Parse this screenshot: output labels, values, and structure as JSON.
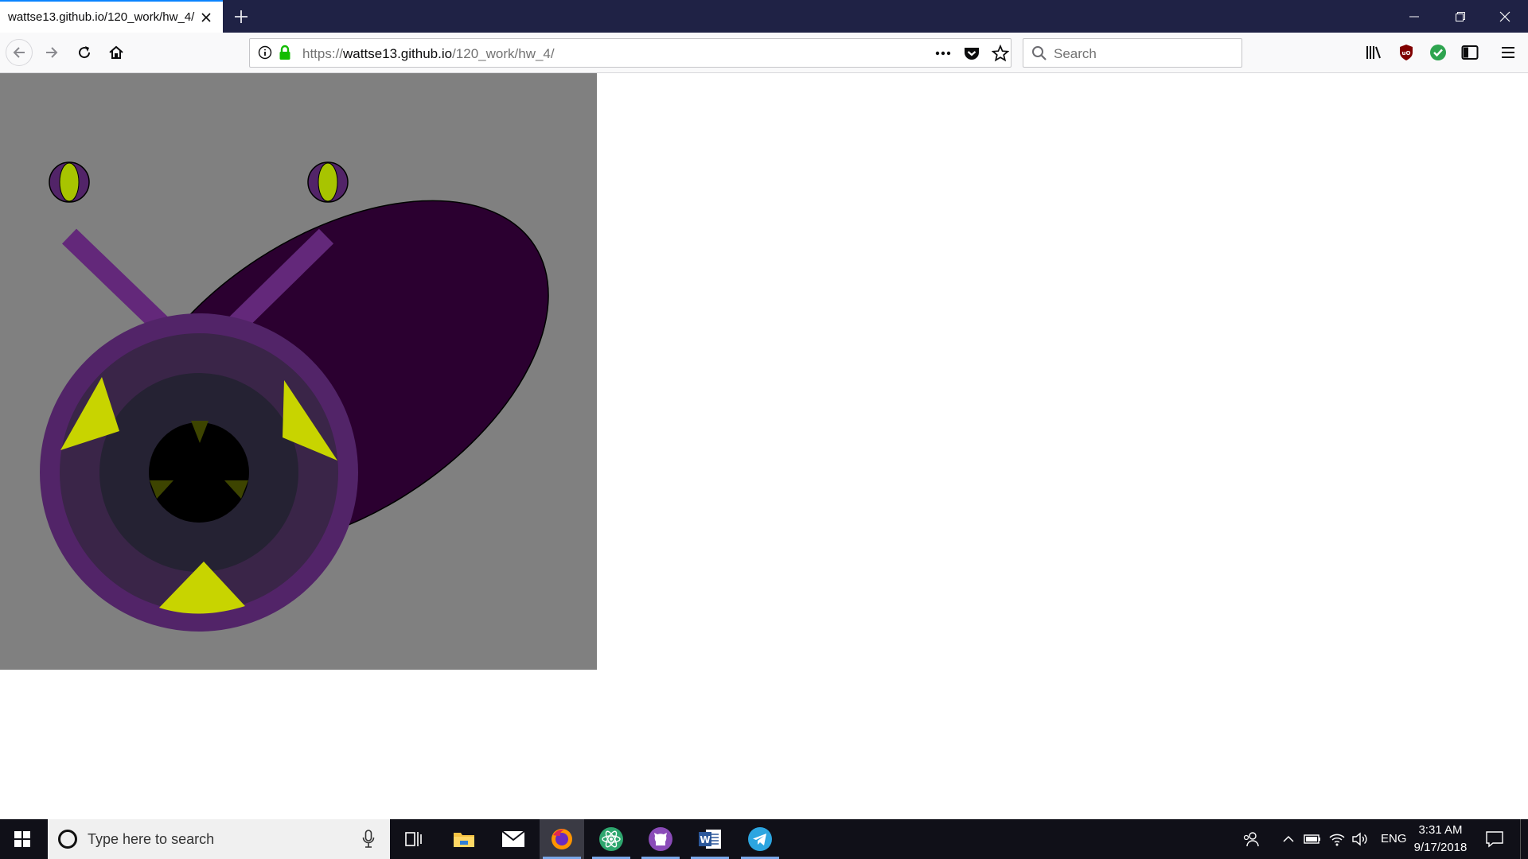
{
  "browser": {
    "tab_title": "wattse13.github.io/120_work/hw_4/",
    "url_prefix": "https://",
    "url_host": "wattse13.github.io",
    "url_path": "/120_work/hw_4/",
    "search_placeholder": "Search"
  },
  "icons": {
    "tab_close": "close-icon",
    "new_tab": "plus-icon",
    "back": "back-arrow-icon",
    "forward": "forward-arrow-icon",
    "reload": "reload-icon",
    "home": "home-icon",
    "site_info": "info-icon",
    "lock": "lock-icon",
    "page_actions": "more-dots-icon",
    "pocket": "pocket-icon",
    "bookmark": "star-icon",
    "search": "search-icon",
    "library": "library-icon",
    "ublock": "ublock-icon",
    "extension_check": "check-icon",
    "sidebar": "sidebar-icon",
    "menu": "hamburger-menu-icon"
  },
  "canvas": {
    "background": "#808080",
    "body_color": "#2b0030",
    "antenna_color": "#63287a",
    "outer_ring_color": "#522468",
    "middle_ring_color": "#3a2548",
    "inner_color": "#252233",
    "pupil_color": "#000000",
    "accent_color": "#c8d400",
    "dark_accent_color": "#3d4400"
  },
  "taskbar": {
    "search_placeholder": "Type here to search",
    "language": "ENG",
    "time": "3:31 AM",
    "date": "9/17/2018",
    "apps": [
      "task-view",
      "file-explorer",
      "mail",
      "firefox",
      "atom",
      "github-desktop",
      "word",
      "telegram"
    ]
  }
}
